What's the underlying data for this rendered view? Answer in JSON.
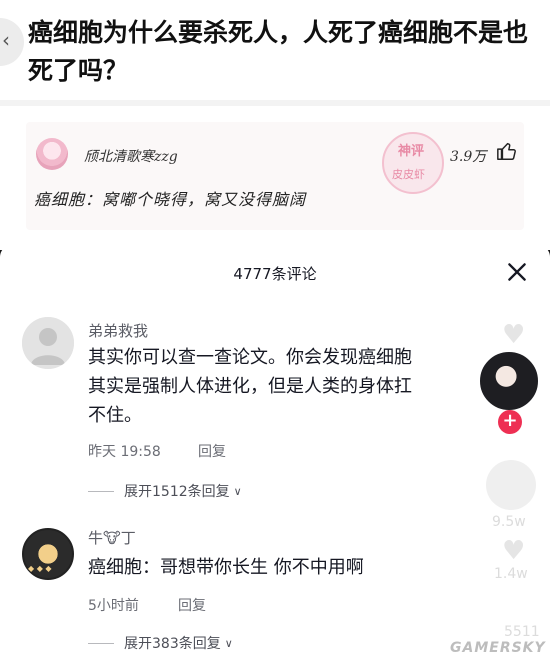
{
  "question": {
    "back_glyph": "‹",
    "title": "癌细胞为什么要杀死人，人死了癌细胞不是也死了吗？"
  },
  "answer": {
    "username": "颀北清歌寒zzg",
    "likes": "3.9万",
    "text": "癌细胞：窝嘟个晓得，窝又没得脑阔",
    "stamp_top": "神评",
    "stamp_bottom": "皮皮虾"
  },
  "comments_sheet": {
    "title": "4777条评论",
    "comments": [
      {
        "name": "弟弟救我",
        "body_lines": [
          "其实你可以查一查论文。你会发现癌细胞",
          "其实是强制人体进化，但是人类的身体扛",
          "不住。"
        ],
        "time": "昨天 19:58",
        "reply_label": "回复",
        "expand_label": "展开1512条回复"
      },
      {
        "name": "牛🐮丁",
        "body_lines": [
          "癌细胞：哥想带你长生  你不中用啊"
        ],
        "time": "5小时前",
        "reply_label": "回复",
        "expand_label": "展开383条回复"
      }
    ]
  },
  "right_rail": {
    "share_count": "9.5w",
    "comment_count": "1.4w",
    "extra_count": "5511"
  },
  "watermark": "GAMERSKY",
  "colors": {
    "follow_red": "#ee2f53",
    "stamp_pink": "#e88aa5"
  },
  "icons": [
    "back-icon",
    "thumbs-up-icon",
    "close-icon",
    "chevron-down-icon",
    "heart-icon",
    "plus-icon"
  ]
}
